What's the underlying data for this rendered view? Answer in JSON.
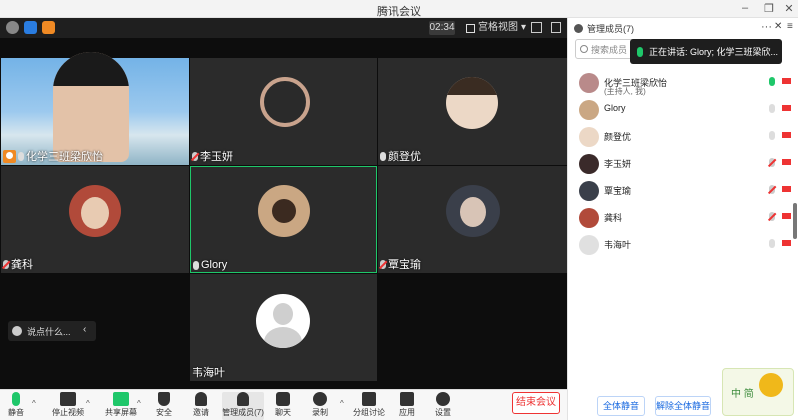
{
  "window": {
    "title": "腾讯会议"
  },
  "header": {
    "timer": "02:34",
    "view_label": "宫格视图"
  },
  "tiles": [
    {
      "name": "化学三班梁欣怡",
      "mic": "on",
      "host": true
    },
    {
      "name": "李玉妍",
      "mic": "off"
    },
    {
      "name": "颜登优",
      "mic": "on"
    },
    {
      "name": "龚科",
      "mic": "off"
    },
    {
      "name": "Glory",
      "mic": "on",
      "active": true
    },
    {
      "name": "覃宝瑜",
      "mic": "off"
    },
    {
      "name": "韦海叶",
      "mic": "none"
    }
  ],
  "chat": {
    "placeholder": "说点什么..."
  },
  "toolbar": {
    "mute": "静音",
    "stop_video": "停止视频",
    "share": "共享屏幕",
    "security": "安全",
    "invite": "邀请",
    "manage": "管理成员(7)",
    "chat": "聊天",
    "record": "录制",
    "breakout": "分组讨论",
    "apps": "应用",
    "settings": "设置",
    "end": "结束会议"
  },
  "panel": {
    "title": "管理成员(7)",
    "search_placeholder": "搜索成员",
    "speaking": "正在讲话: Glory; 化学三班梁欣...",
    "members": [
      {
        "name": "化学三班梁欣怡",
        "sub": "(主持人, 我)",
        "mic": "on-green",
        "cam": "on"
      },
      {
        "name": "Glory",
        "mic": "on",
        "cam": "on"
      },
      {
        "name": "颜登优",
        "mic": "on",
        "cam": "on"
      },
      {
        "name": "李玉妍",
        "mic": "off",
        "cam": "on"
      },
      {
        "name": "覃宝瑜",
        "mic": "off",
        "cam": "on"
      },
      {
        "name": "龚科",
        "mic": "off",
        "cam": "on"
      },
      {
        "name": "韦海叶",
        "mic": "on",
        "cam": "on"
      }
    ],
    "mute_all": "全体静音",
    "unmute_all": "解除全体静音"
  },
  "widget": {
    "text": "中 简"
  },
  "colors": {
    "accent": "#1fc76a",
    "end": "#e33333",
    "link": "#1a6ae0"
  }
}
